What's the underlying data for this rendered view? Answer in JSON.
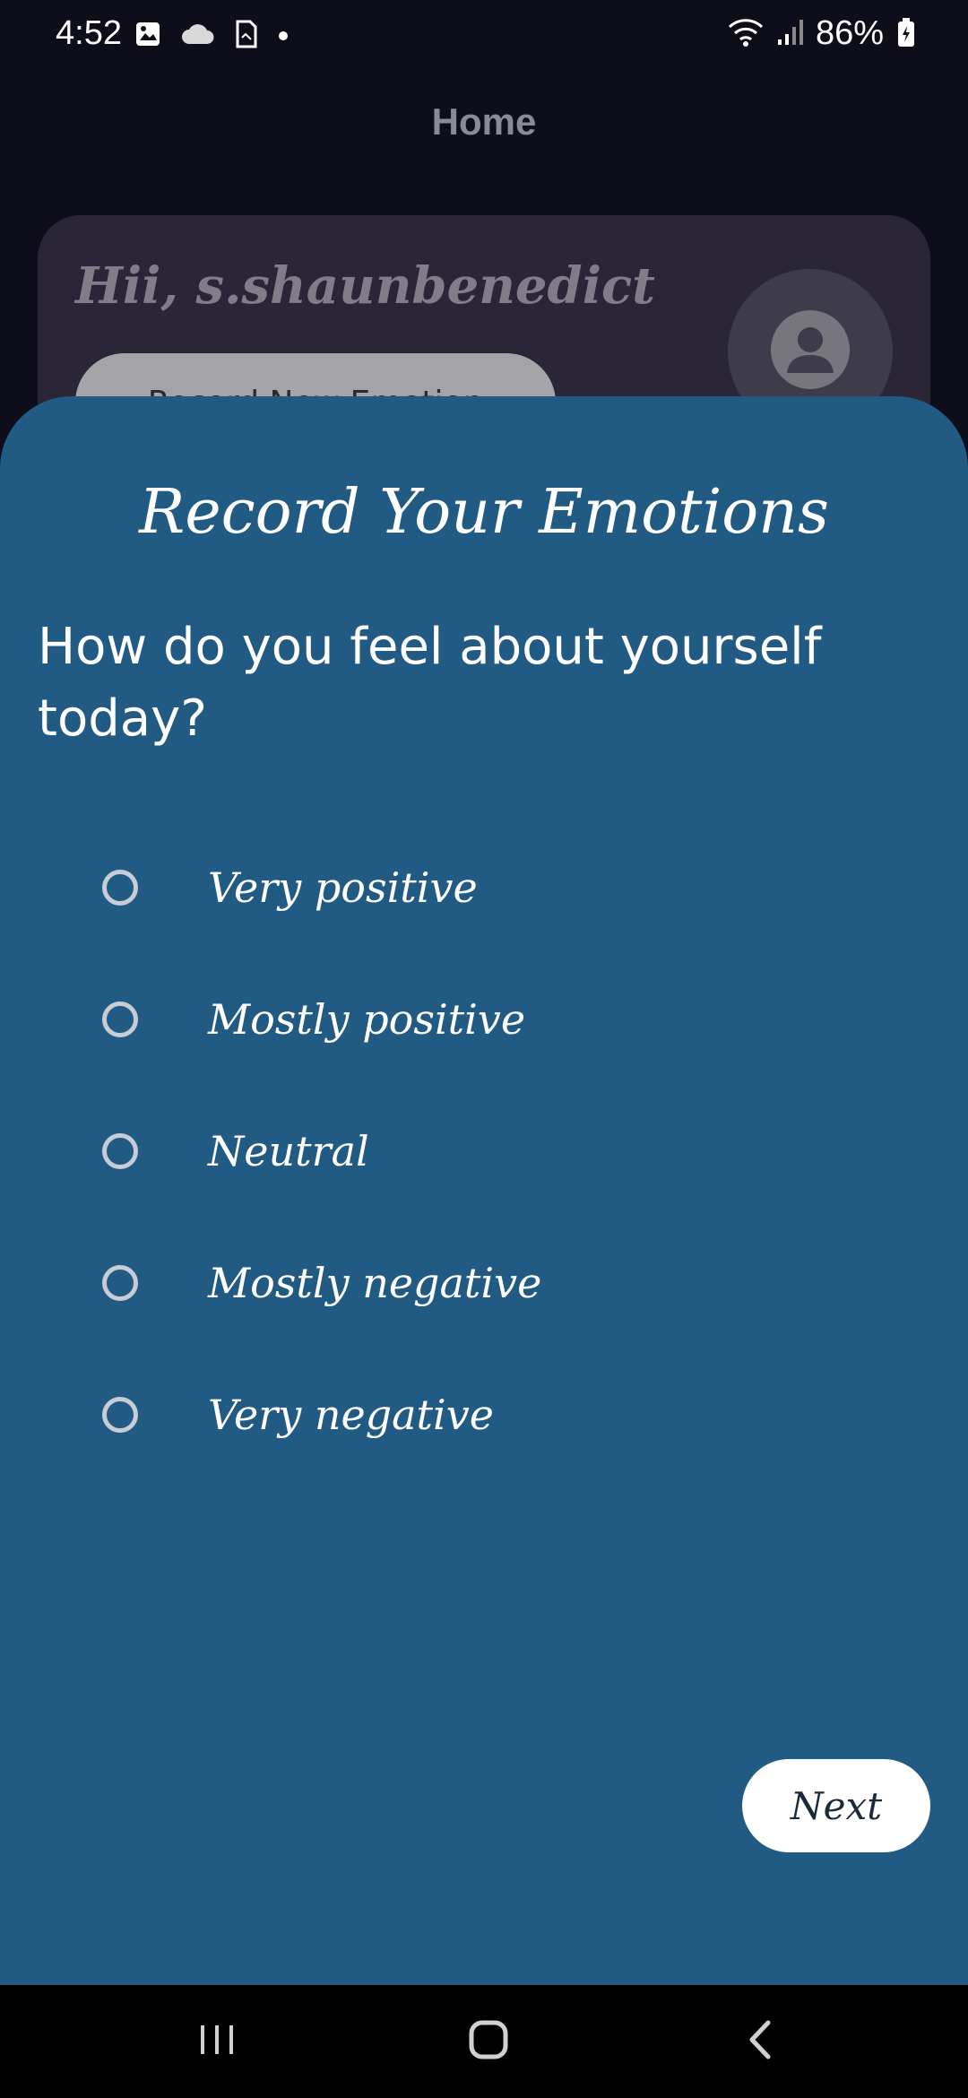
{
  "status_bar": {
    "time": "4:52",
    "battery": "86%",
    "left_icons": [
      "image-icon",
      "cloud-icon",
      "file-icon",
      "dot-icon"
    ],
    "right_icons": [
      "wifi-icon",
      "signal-icon",
      "battery-icon"
    ]
  },
  "app_bar": {
    "title": "Home"
  },
  "home_card": {
    "greeting": "Hii, s.shaunbenedict",
    "record_button_label": "Record New Emotion",
    "avatar_icon": "person-icon"
  },
  "sheet": {
    "title": "Record Your Emotions",
    "question": "How do you feel about yourself today?",
    "options": [
      {
        "label": "Very positive",
        "selected": false
      },
      {
        "label": "Mostly positive",
        "selected": false
      },
      {
        "label": "Neutral",
        "selected": false
      },
      {
        "label": "Mostly negative",
        "selected": false
      },
      {
        "label": "Very negative",
        "selected": false
      }
    ],
    "next_label": "Next"
  },
  "nav_bar": {
    "icons": [
      "recent-apps-icon",
      "home-icon",
      "back-icon"
    ]
  },
  "colors": {
    "background": "#0e0e1a",
    "sheet": "#215a83",
    "card": "#2a2638",
    "radio_border": "#c8ccd6",
    "next_button": "#ffffff"
  }
}
